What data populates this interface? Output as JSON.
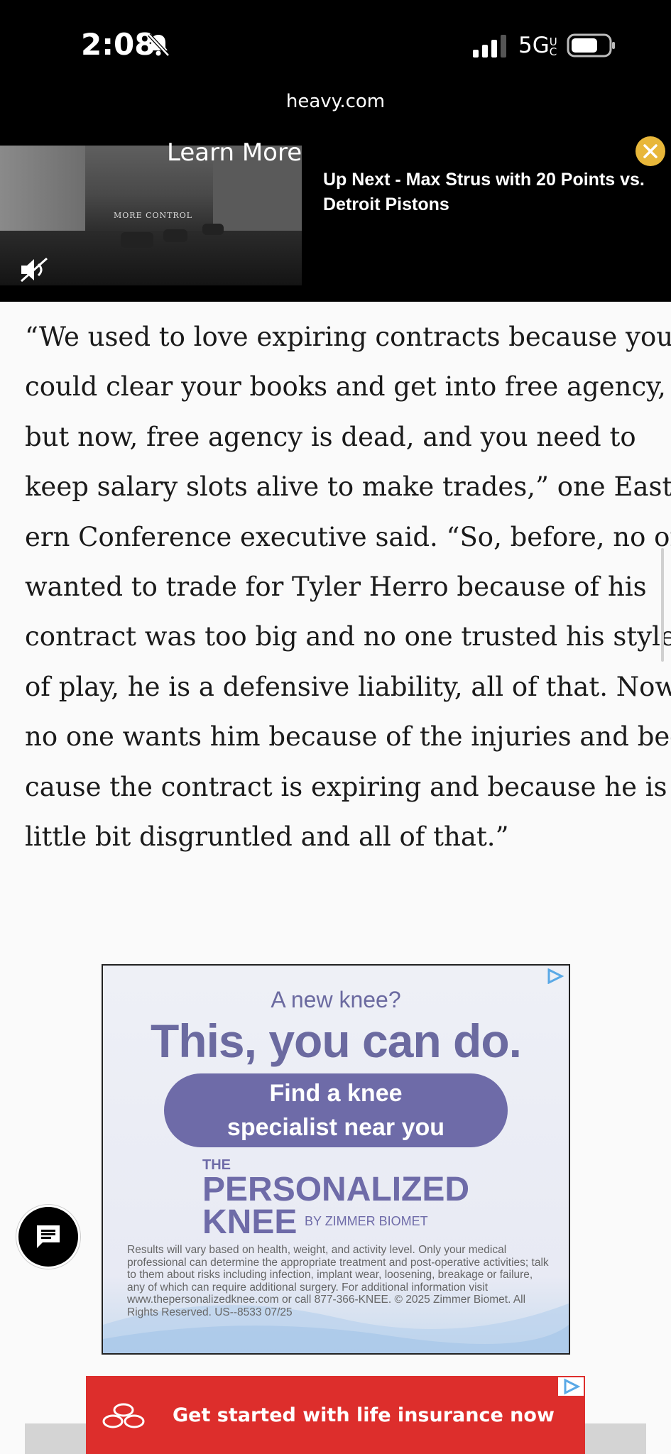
{
  "status_bar": {
    "time": "2:08",
    "network": "5G",
    "network_suffix": "UC"
  },
  "browser": {
    "url": "heavy.com"
  },
  "video_player": {
    "overlay_label": "Learn More",
    "caption": "MORE CONTROL",
    "up_next": "Up Next - Max Strus with 20 Points vs. Detroit Pistons"
  },
  "article": {
    "lines": [
      "“We used to love expiring contracts because you",
      "could clear your books and get into free agency,",
      "but now, free agency is dead, and you need to",
      "keep salary slots alive to make trades,” one East-",
      "ern Conference executive said. “So, before, no one",
      "wanted to trade for Tyler Herro because of his",
      "contract was too big and no one trusted his style",
      "of play, he is a defensive liability, all of that. Now,",
      "no one wants him because of the injuries and be-",
      "cause the contract is expiring and because he is a",
      "little bit disgruntled and all of that.”"
    ]
  },
  "knee_ad": {
    "eyebrow": "A new knee?",
    "headline": "This, you can do.",
    "cta_line1": "Find a knee",
    "cta_line2": "specialist near you",
    "brand_the": "THE",
    "brand_line1": "PERSONALIZED",
    "brand_line2": "KNEE",
    "brand_by": "BY ZIMMER BIOMET",
    "fine_print": "Results will vary based on health, weight, and activity level. Only your medical professional can determine the appropriate treatment and post-operative activities; talk to them about risks including infection, implant wear, loosening, breakage or failure, any of which can require additional surgery. For additional information visit www.thepersonalizedknee.com or call 877-366-KNEE. © 2025 Zimmer Biomet. All Rights Reserved. US--8533 07/25",
    "accent_color": "#6e6ba8"
  },
  "bottom_ad": {
    "text": "Get started with life insurance now",
    "color": "#dd2e2c"
  },
  "icons": {
    "bell": "bell-slash-icon",
    "mute": "mute-icon",
    "close": "close-icon",
    "chat": "chat-icon",
    "ad_choices": "ad-choices-icon"
  }
}
